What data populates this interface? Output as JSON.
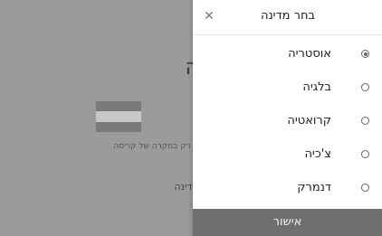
{
  "background": {
    "title_fragment": "ה",
    "hint_fragment": "ש רק במקרה של קריסה",
    "field_label_fragment": "מדינה",
    "flag": {
      "colors": [
        "#ed2939",
        "#ffffff",
        "#ed2939"
      ],
      "shown_as": "dimmed"
    }
  },
  "dialog": {
    "title": "בחר מדינה",
    "close_icon": "close-icon",
    "options": [
      {
        "label": "אוסטריה",
        "selected": true
      },
      {
        "label": "בלגיה",
        "selected": false
      },
      {
        "label": "קרואטיה",
        "selected": false
      },
      {
        "label": "צ'כיה",
        "selected": false
      },
      {
        "label": "דנמרק",
        "selected": false
      }
    ],
    "confirm_label": "אישור"
  },
  "colors": {
    "overlay": "#9b9b9b",
    "confirm_button": "#6f6f6f"
  }
}
